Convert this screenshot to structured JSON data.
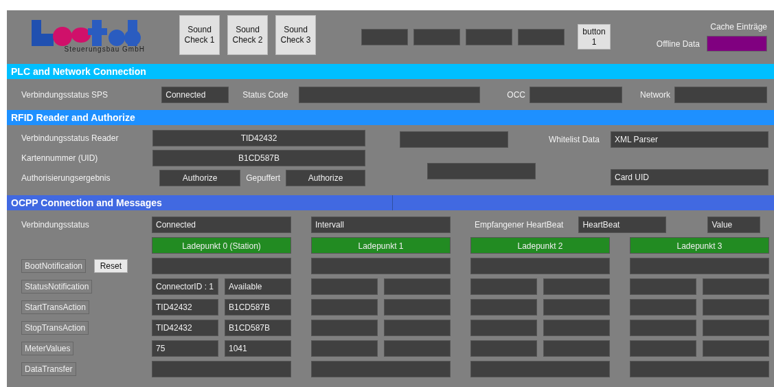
{
  "header": {
    "logo_subtitle": "Steuerungsbau GmbH",
    "sound_buttons": [
      "Sound Check 1",
      "Sound Check 2",
      "Sound Check 3"
    ],
    "button": "button 1",
    "cache_label": "Cache Einträge",
    "offline_label": "Offline Data"
  },
  "plc": {
    "title": "PLC and Network Connection",
    "connection_label": "Verbindungsstatus SPS",
    "connection_value": "Connected",
    "status_code_label": "Status Code",
    "occ_label": "OCC",
    "network_label": "Network"
  },
  "rfid": {
    "title": "RFID Reader and Authorize",
    "reader_label": "Verbindungsstatus Reader",
    "reader_value": "TID42432",
    "uid_label": "Kartennummer (UID)",
    "uid_value": "B1CD587B",
    "auth_label": "Authorisierungsergebnis",
    "auth_value": "Authorize",
    "buffered_label": "Gepuffert",
    "buffered_value": "Authorize",
    "whitelist_label": "Whitelist Data",
    "whitelist_value": "XML Parser",
    "card_uid_value": "Card UID"
  },
  "ocpp": {
    "title": "OCPP Connection and Messages",
    "connection_label": "Verbindungsstatus",
    "connection_value": "Connected",
    "interval_value": "Intervall",
    "heartbeat_label": "Empfangener HeartBeat",
    "heartbeat_value": "HeartBeat",
    "value_field": "Value",
    "reset_button": "Reset",
    "charge_points": [
      "Ladepunkt 0 (Station)",
      "Ladepunkt 1",
      "Ladepunkt 2",
      "Ladepunkt 3"
    ],
    "messages": [
      {
        "label": "BootNotification",
        "kind": "single"
      },
      {
        "label": "StatusNotification",
        "kind": "pair",
        "station_values": [
          "ConnectorID : 1",
          "Available"
        ]
      },
      {
        "label": "StartTransAction",
        "kind": "pair",
        "station_values": [
          "TID42432",
          "B1CD587B"
        ]
      },
      {
        "label": "StopTransAction",
        "kind": "pair",
        "station_values": [
          "TID42432",
          "B1CD587B"
        ]
      },
      {
        "label": "MeterValues",
        "kind": "pair",
        "station_values": [
          "75",
          "1041"
        ]
      },
      {
        "label": "DataTransfer",
        "kind": "single"
      }
    ]
  }
}
